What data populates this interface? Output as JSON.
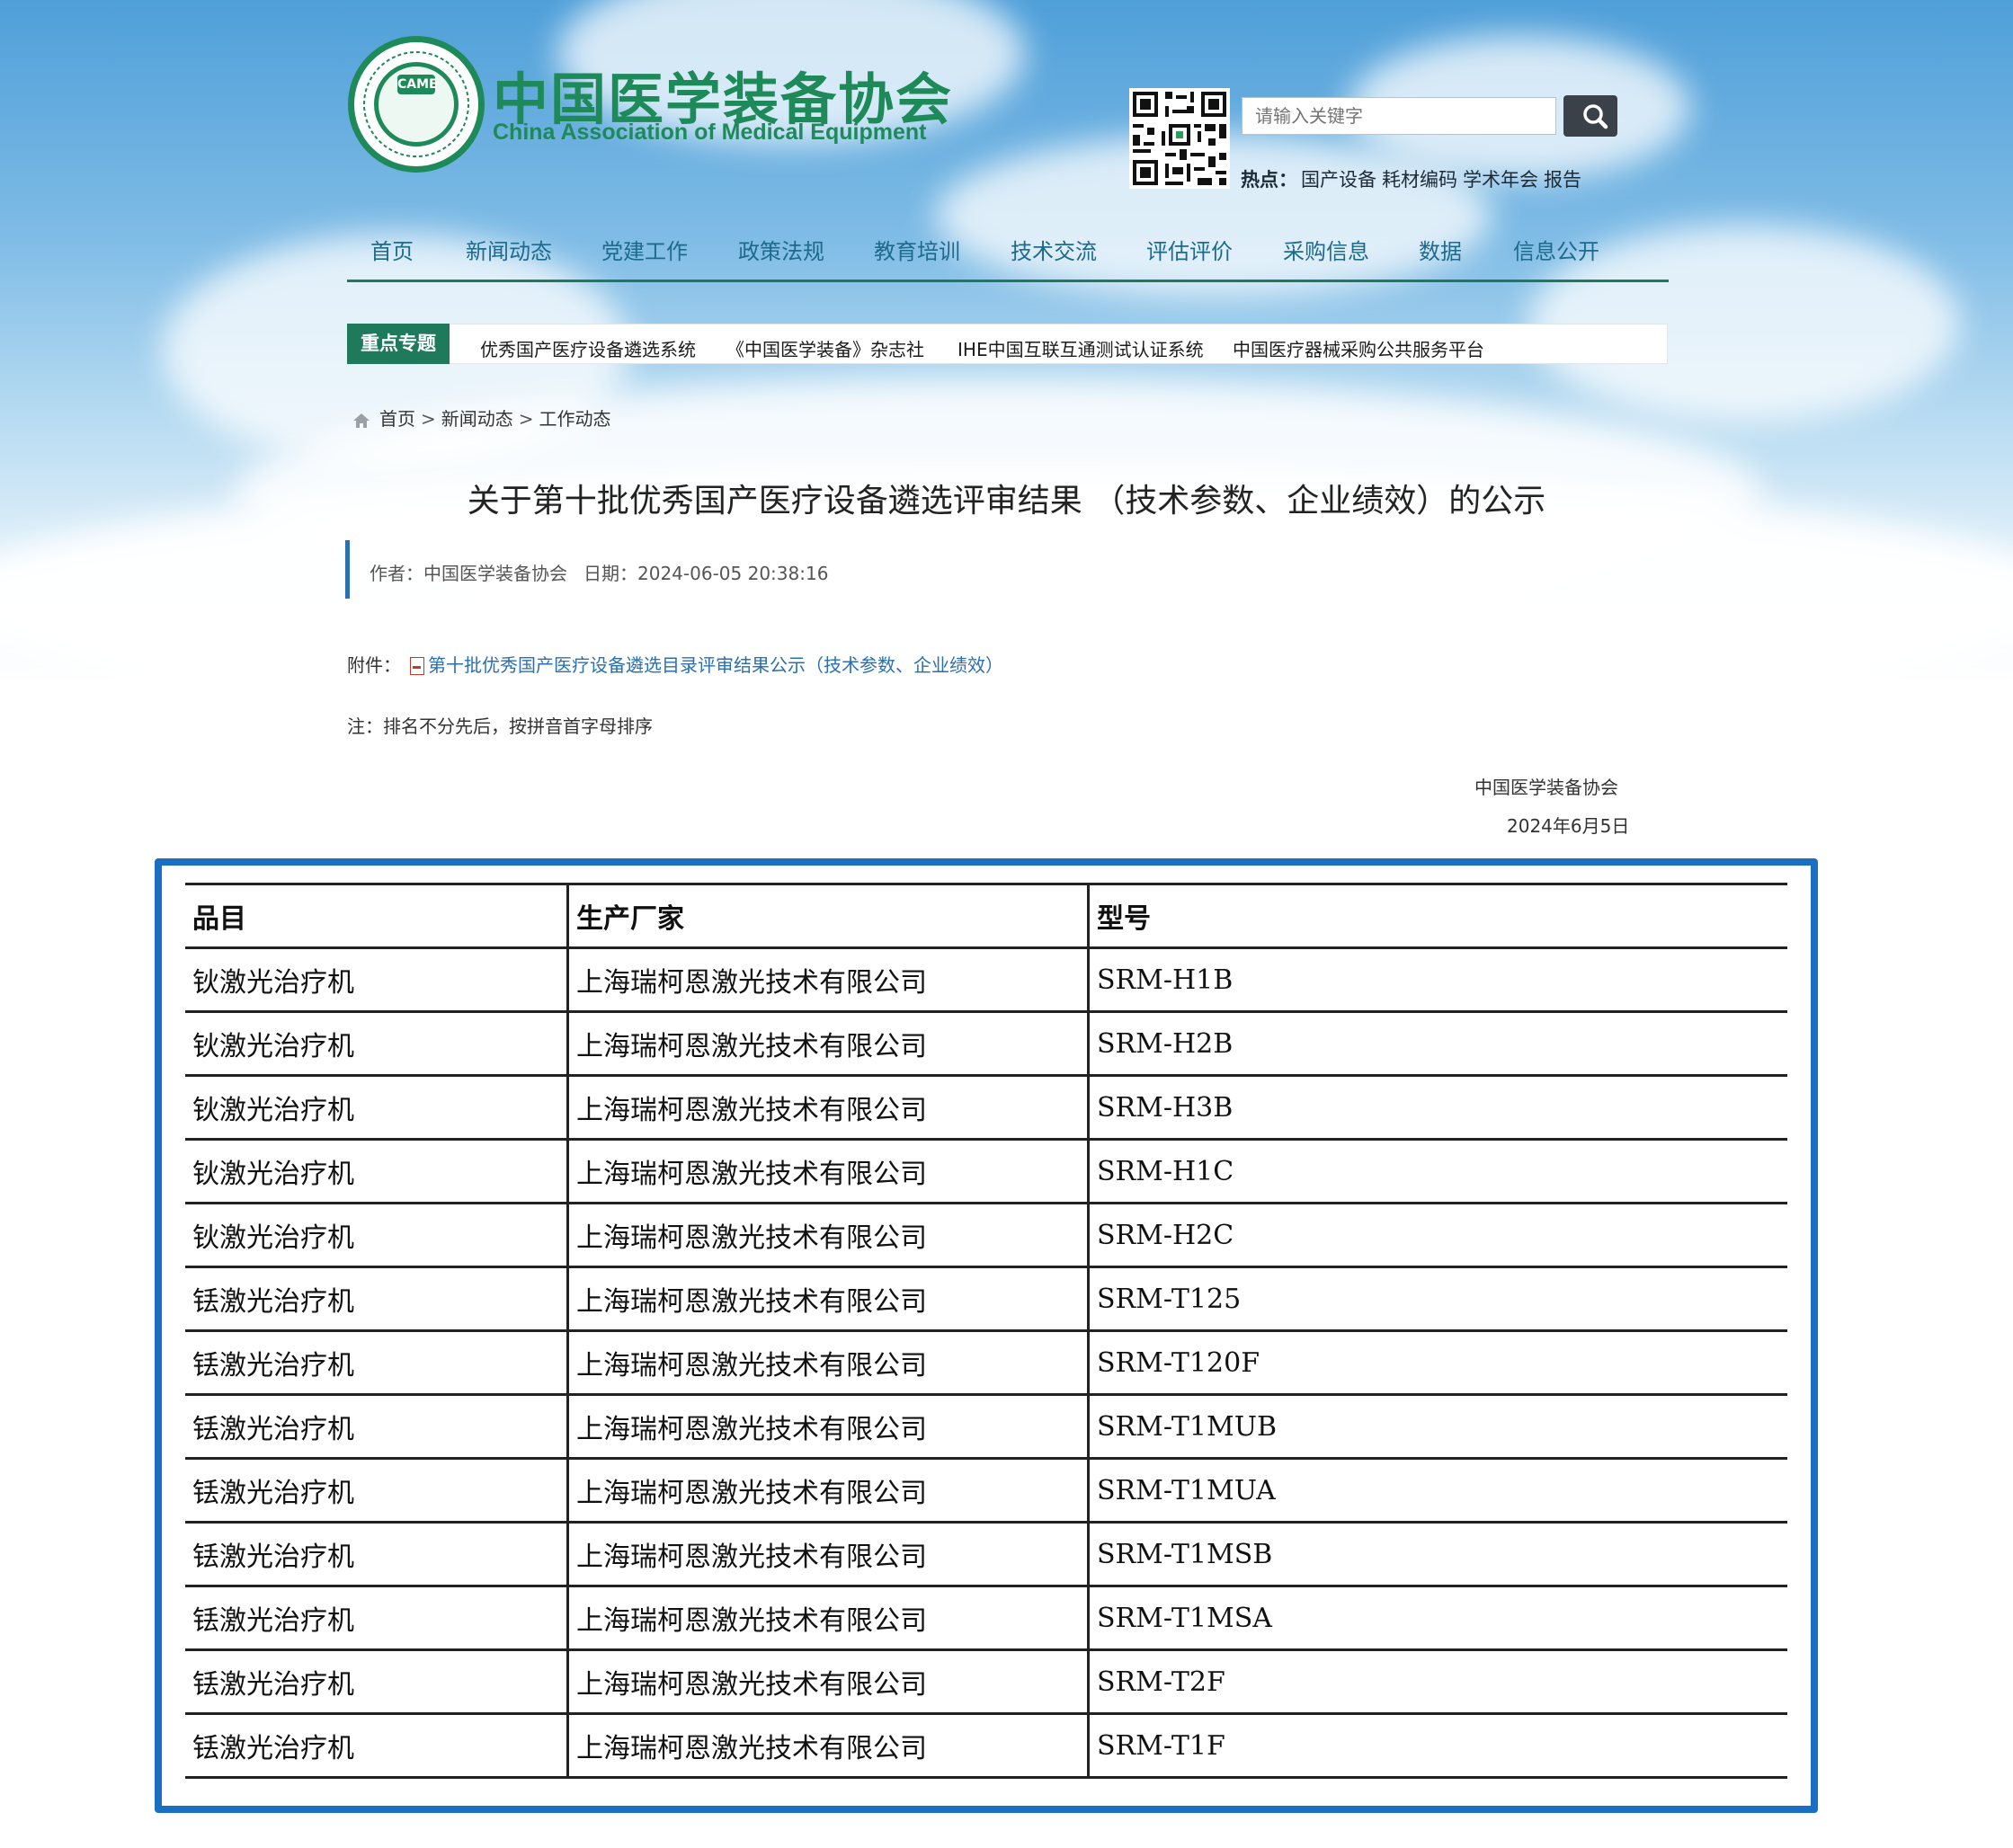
{
  "header": {
    "logo_cn": "中国医学装备协会",
    "logo_en": "China Association of Medical Equipment",
    "emblem_text": "CAME",
    "search_placeholder": "请输入关键字",
    "hot_label": "热点：",
    "hot_links": [
      "国产设备",
      "耗材编码",
      "学术年会",
      "报告"
    ]
  },
  "nav": {
    "items": [
      "首页",
      "新闻动态",
      "党建工作",
      "政策法规",
      "教育培训",
      "技术交流",
      "评估评价",
      "采购信息",
      "数据",
      "信息公开"
    ]
  },
  "focus": {
    "label": "重点专题",
    "links": [
      "优秀国产医疗设备遴选系统",
      "《中国医学装备》杂志社",
      "IHE中国互联互通测试认证系统",
      "中国医疗器械采购公共服务平台"
    ]
  },
  "breadcrumb": {
    "items": [
      "首页",
      "新闻动态",
      "工作动态"
    ],
    "separator": ">"
  },
  "article": {
    "title": "关于第十批优秀国产医疗设备遴选评审结果 （技术参数、企业绩效）的公示",
    "author_label": "作者：",
    "author": "中国医学装备协会",
    "date_label": "日期：",
    "date": "2024-06-05 20:38:16",
    "attach_label": "附件：",
    "attach_link": "第十批优秀国产医疗设备遴选目录评审结果公示（技术参数、企业绩效）",
    "note": "注：排名不分先后，按拼音首字母排序",
    "sign_org": "中国医学装备协会",
    "sign_date": "2024年6月5日"
  },
  "table": {
    "headers": [
      "品目",
      "生产厂家",
      "型号"
    ],
    "rows": [
      [
        "钬激光治疗机",
        "上海瑞柯恩激光技术有限公司",
        "SRM-H1B"
      ],
      [
        "钬激光治疗机",
        "上海瑞柯恩激光技术有限公司",
        "SRM-H2B"
      ],
      [
        "钬激光治疗机",
        "上海瑞柯恩激光技术有限公司",
        "SRM-H3B"
      ],
      [
        "钬激光治疗机",
        "上海瑞柯恩激光技术有限公司",
        "SRM-H1C"
      ],
      [
        "钬激光治疗机",
        "上海瑞柯恩激光技术有限公司",
        "SRM-H2C"
      ],
      [
        "铥激光治疗机",
        "上海瑞柯恩激光技术有限公司",
        "SRM-T125"
      ],
      [
        "铥激光治疗机",
        "上海瑞柯恩激光技术有限公司",
        "SRM-T120F"
      ],
      [
        "铥激光治疗机",
        "上海瑞柯恩激光技术有限公司",
        "SRM-T1MUB"
      ],
      [
        "铥激光治疗机",
        "上海瑞柯恩激光技术有限公司",
        "SRM-T1MUA"
      ],
      [
        "铥激光治疗机",
        "上海瑞柯恩激光技术有限公司",
        "SRM-T1MSB"
      ],
      [
        "铥激光治疗机",
        "上海瑞柯恩激光技术有限公司",
        "SRM-T1MSA"
      ],
      [
        "铥激光治疗机",
        "上海瑞柯恩激光技术有限公司",
        "SRM-T2F"
      ],
      [
        "铥激光治疗机",
        "上海瑞柯恩激光技术有限公司",
        "SRM-T1F"
      ]
    ]
  },
  "colors": {
    "brand_green": "#1e8a5a",
    "nav_text": "#1d6a8c",
    "link_blue": "#2a6fb0",
    "frame_blue": "#1a6fc2"
  }
}
